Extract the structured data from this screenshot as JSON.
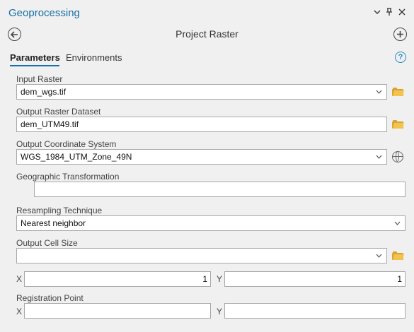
{
  "pane": {
    "title": "Geoprocessing"
  },
  "tool": {
    "title": "Project Raster"
  },
  "tabs": [
    {
      "label": "Parameters",
      "active": true
    },
    {
      "label": "Environments",
      "active": false
    }
  ],
  "params": {
    "input_raster": {
      "label": "Input Raster",
      "value": "dem_wgs.tif"
    },
    "output_raster": {
      "label": "Output Raster Dataset",
      "value": "dem_UTM49.tif"
    },
    "output_cs": {
      "label": "Output Coordinate System",
      "value": "WGS_1984_UTM_Zone_49N"
    },
    "geo_transform": {
      "label": "Geographic Transformation",
      "value": ""
    },
    "resampling": {
      "label": "Resampling Technique",
      "value": "Nearest neighbor"
    },
    "cell_size": {
      "label": "Output Cell Size",
      "value": "",
      "x_label": "X",
      "x_value": "1",
      "y_label": "Y",
      "y_value": "1"
    },
    "registration": {
      "label": "Registration Point",
      "x_label": "X",
      "x_value": "",
      "y_label": "Y",
      "y_value": ""
    }
  },
  "colors": {
    "accent": "#1570a6",
    "folder": "#f2c34d",
    "help": "#2a86c8"
  },
  "icons": [
    "chevron-down-icon",
    "pin-icon",
    "close-icon",
    "back-arrow-icon",
    "add-icon",
    "help-icon",
    "folder-icon",
    "globe-icon"
  ],
  "symbols": {
    "chevron": "⌄",
    "pin": "ꟸ",
    "close": "✕",
    "help": "?"
  }
}
